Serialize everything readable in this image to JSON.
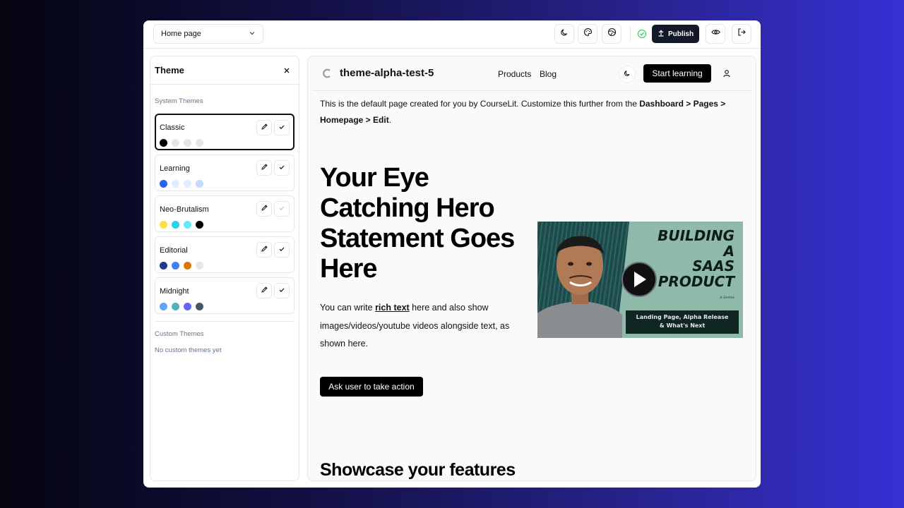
{
  "topbar": {
    "page_select": "Home page",
    "publish_label": "Publish"
  },
  "sidebar": {
    "title": "Theme",
    "system_section": "System Themes",
    "themes": [
      {
        "name": "Classic",
        "colors": [
          "#000000",
          "#e5e5e5",
          "#e5e5e5",
          "#e5e5e5"
        ]
      },
      {
        "name": "Learning",
        "colors": [
          "#2563eb",
          "#e0ecff",
          "#e0ecff",
          "#bfdbfe"
        ]
      },
      {
        "name": "Neo-Brutalism",
        "colors": [
          "#fde047",
          "#22d3ee",
          "#67e8f9",
          "#000000"
        ]
      },
      {
        "name": "Editorial",
        "colors": [
          "#1e3a8a",
          "#3b82f6",
          "#d97706",
          "#e5e7eb"
        ]
      },
      {
        "name": "Midnight",
        "colors": [
          "#60a5fa",
          "#4fb3bf",
          "#6366f1",
          "#475569"
        ]
      }
    ],
    "custom_section": "Custom Themes",
    "custom_empty": "No custom themes yet"
  },
  "site": {
    "title": "theme-alpha-test-5",
    "nav": [
      "Products",
      "Blog"
    ],
    "start_label": "Start learning",
    "intro_1": "This is the default page created for you by CourseLit. Customize this further from the ",
    "intro_bold": "Dashboard > Pages > Homepage > Edit",
    "intro_end": ".",
    "hero_title": "Your Eye Catching Hero Statement Goes Here",
    "hero_body_1": "You can write ",
    "hero_body_rich": "rich text",
    "hero_body_2": " here and also show images/videos/youtube videos alongside text, as shown here.",
    "cta_label": "Ask user to take action",
    "features_title": "Showcase your features",
    "video": {
      "title_lines": [
        "BUILDING",
        "A",
        "SAAS",
        "PRODUCT"
      ],
      "series": "A Series",
      "caption_1": "Landing Page, Alpha Release",
      "caption_2": "& What's Next"
    }
  }
}
